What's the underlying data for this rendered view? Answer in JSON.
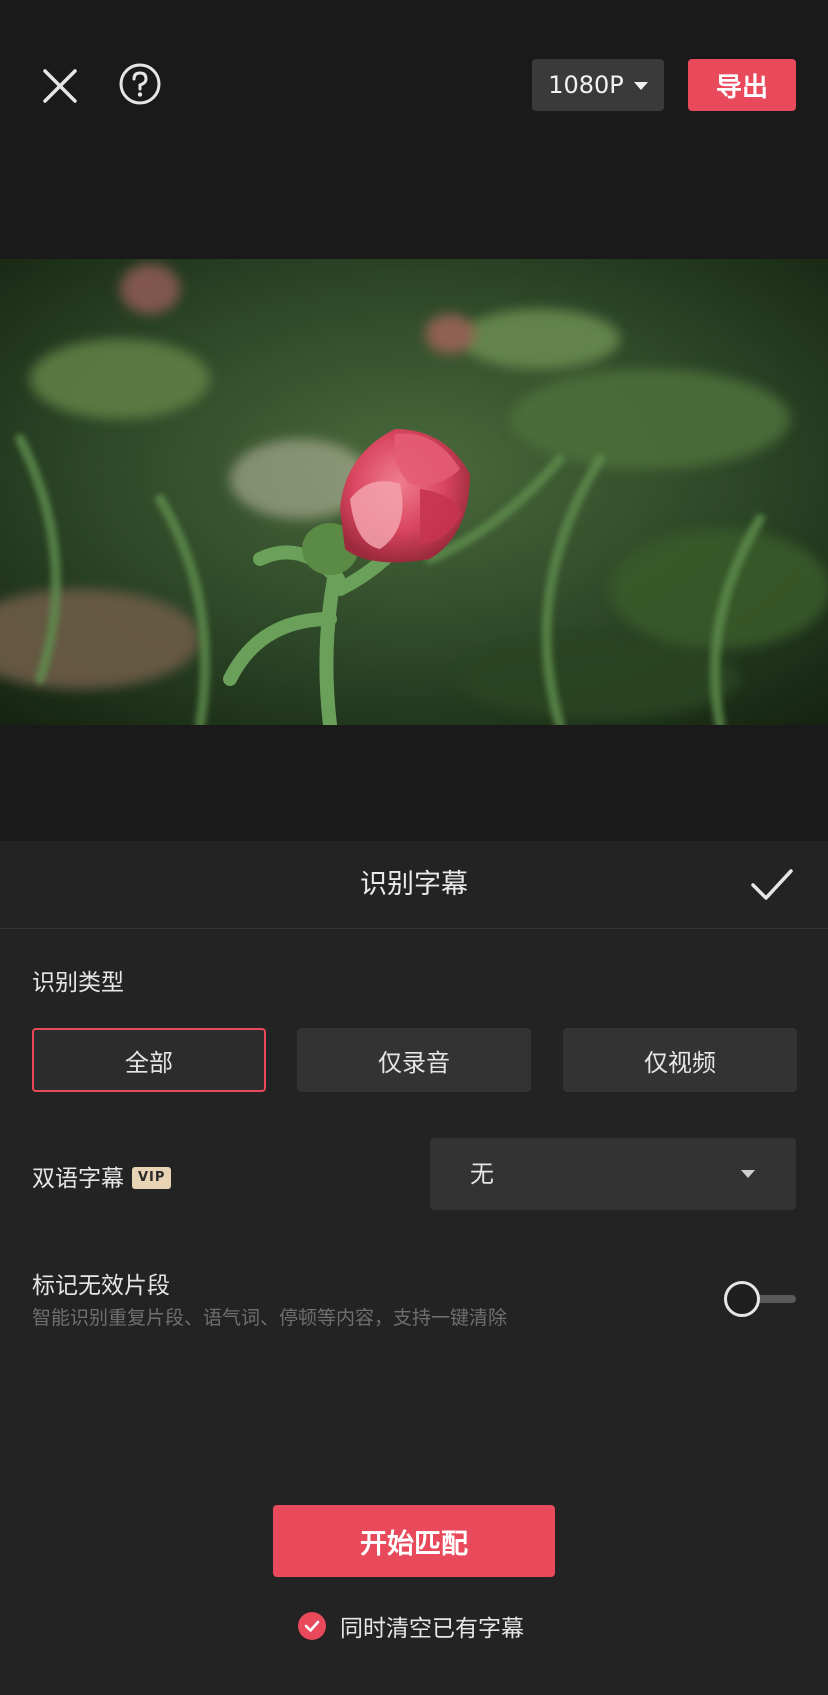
{
  "toolbar": {
    "close_icon": "close-icon",
    "help_icon": "help-icon",
    "resolution_label": "1080P",
    "export_label": "导出"
  },
  "preview": {
    "image_subject": "pink rose bud with green leaves"
  },
  "panel": {
    "title": "识别字幕",
    "recognition_type": {
      "label": "识别类型",
      "options": [
        "全部",
        "仅录音",
        "仅视频"
      ],
      "selected": "全部"
    },
    "bilingual": {
      "label": "双语字幕",
      "badge": "VIP",
      "value": "无"
    },
    "invalid_segments": {
      "label": "标记无效片段",
      "description": "智能识别重复片段、语气词、停顿等内容，支持一键清除",
      "enabled": false
    },
    "start_button": "开始匹配",
    "clear_existing": {
      "label": "同时清空已有字幕",
      "checked": true
    }
  },
  "colors": {
    "accent": "#e8495b",
    "background": "#1a1a1a",
    "panel": "#232323",
    "control": "#333333"
  }
}
